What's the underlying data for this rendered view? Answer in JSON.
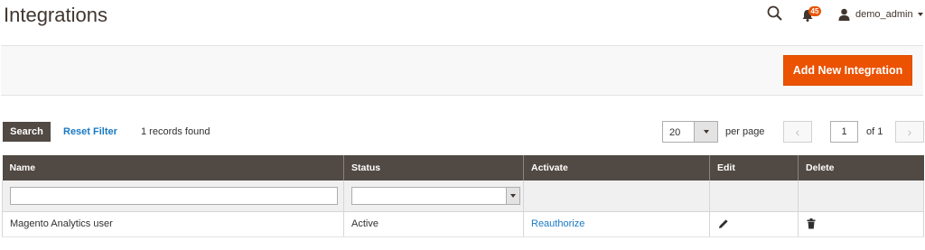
{
  "page": {
    "title": "Integrations"
  },
  "header": {
    "search_icon": "search-icon",
    "notifications": {
      "icon": "bell-icon",
      "count": "45"
    },
    "user": {
      "icon": "user-icon",
      "name": "demo_admin"
    }
  },
  "actions": {
    "add_new_label": "Add New Integration"
  },
  "toolbar": {
    "search_label": "Search",
    "reset_label": "Reset Filter",
    "records_found": "1 records found",
    "per_page_value": "20",
    "per_page_label": "per page",
    "current_page": "1",
    "of_pages": "of 1",
    "prev_icon": "chevron-left-icon",
    "next_icon": "chevron-right-icon"
  },
  "grid": {
    "columns": [
      "Name",
      "Status",
      "Activate",
      "Edit",
      "Delete"
    ],
    "rows": [
      {
        "name": "Magento Analytics user",
        "status": "Active",
        "activate": "Reauthorize",
        "edit_icon": "pencil-icon",
        "delete_icon": "trash-icon"
      }
    ]
  },
  "colors": {
    "accent": "#eb5202",
    "header_bg": "#514943",
    "link": "#1979c3"
  }
}
